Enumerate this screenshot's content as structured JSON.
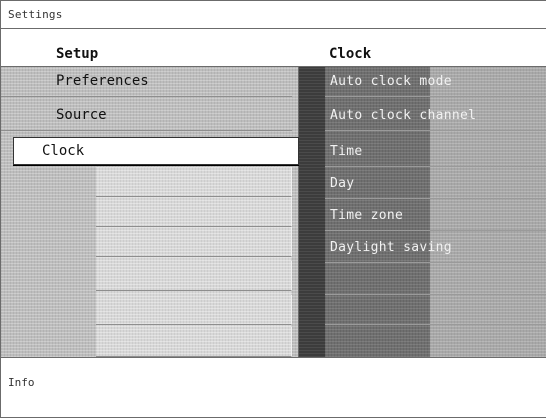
{
  "window": {
    "title": "Settings"
  },
  "columns": {
    "left_header": "Setup",
    "right_header": "Clock"
  },
  "left_menu": {
    "items": [
      {
        "label": "Preferences",
        "selected": false
      },
      {
        "label": "Source",
        "selected": false
      },
      {
        "label": "Clock",
        "selected": true
      }
    ]
  },
  "clock_menu": {
    "items": [
      {
        "label": "Auto clock mode"
      },
      {
        "label": "Auto clock channel"
      },
      {
        "label": "Time"
      },
      {
        "label": "Day"
      },
      {
        "label": "Time zone"
      },
      {
        "label": "Daylight saving"
      }
    ]
  },
  "footer": {
    "info_label": "Info"
  },
  "colors": {
    "panel_light": "#bdbdbd",
    "panel_dark": "#6f6f6f",
    "selection_bg": "#ffffff"
  }
}
